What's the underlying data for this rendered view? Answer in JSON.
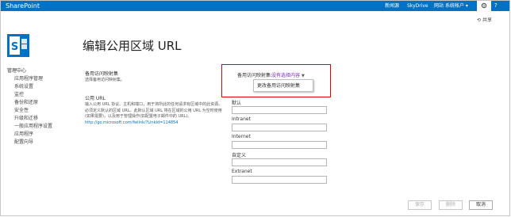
{
  "topbar": {
    "brand": "SharePoint",
    "links": [
      "新闻源",
      "SkyDrive",
      "网站"
    ],
    "account": "系统帐户",
    "help": "?"
  },
  "share": {
    "label": "共享"
  },
  "page": {
    "title": "编辑公用区域 URL"
  },
  "nav": {
    "root": "管理中心",
    "items": [
      "应用程序管理",
      "系统设置",
      "监控",
      "备份和还原",
      "安全性",
      "升级和迁移",
      "一般应用程序设置",
      "应用程序",
      "配置向导"
    ]
  },
  "sections": {
    "mapping": {
      "title": "备用访问映射集",
      "desc": "选择备用访问映射集。"
    },
    "public_url": {
      "title": "公用 URL",
      "desc": "输入公用 URL 协议、主机和端口，用于将所此的任何请求有区域中的此资源。必须定义默认的区域 URL。此默认区域 URL 将在区域的公用 URL 为空时使用(如果需要)，以及用于管理操作(如配置电子邮件中的 URL)。",
      "link": "http://go.microsoft.com/fwlink/?LinkId=114854"
    }
  },
  "mapping_selector": {
    "label": "备用访问映射集:",
    "value": "没有选择内容",
    "menu_item": "更改备用访问映射集"
  },
  "fields": [
    {
      "label": "默认",
      "value": ""
    },
    {
      "label": "Intranet",
      "value": ""
    },
    {
      "label": "Internet",
      "value": ""
    },
    {
      "label": "自定义",
      "value": ""
    },
    {
      "label": "Extranet",
      "value": ""
    }
  ],
  "buttons": {
    "save": "保存",
    "delete": "删除",
    "cancel": "取消"
  },
  "colors": {
    "suite_bar": "#0072c6",
    "highlight": "#e0000a",
    "link": "#0072c6"
  }
}
